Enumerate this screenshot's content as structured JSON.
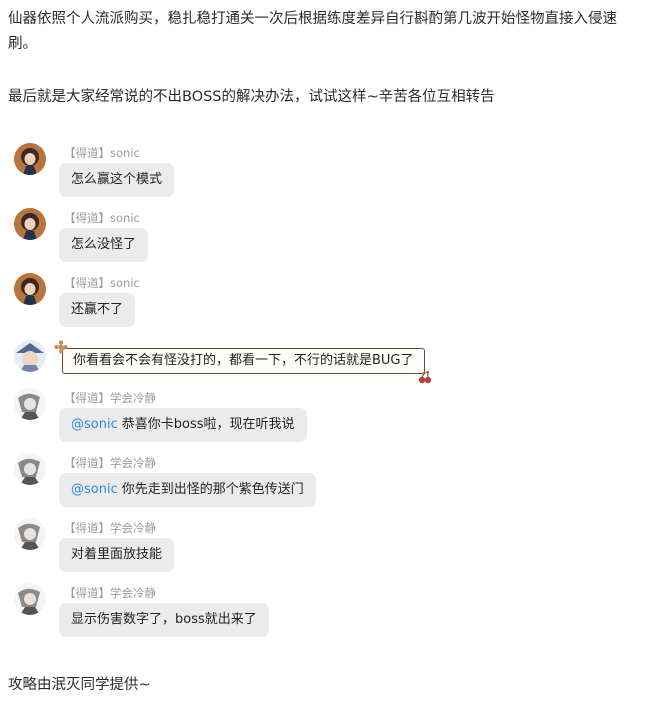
{
  "article": {
    "para1": "仙器依照个人流派购买，稳扎稳打通关一次后根据练度差异自行斟酌第几波开始怪物直接入侵速刷。",
    "para2": "最后就是大家经常说的不出BOSS的解决办法，试试这样~辛苦各位互相转告",
    "footer": "攻略由泯灭同学提供~"
  },
  "chat": {
    "messages": [
      {
        "tag": "【得道】",
        "name": "sonic",
        "text": "怎么赢这个模式"
      },
      {
        "tag": "【得道】",
        "name": "sonic",
        "text": "怎么没怪了"
      },
      {
        "tag": "【得道】",
        "name": "sonic",
        "text": "还赢不了"
      },
      {
        "text": "你看看会不会有怪没打的，都看一下，不行的话就是BUG了"
      },
      {
        "tag": "【得道】",
        "name": "学会冷静",
        "mention": "@sonic",
        "text": "恭喜你卡boss啦，现在听我说"
      },
      {
        "tag": "【得道】",
        "name": "学会冷静",
        "mention": "@sonic",
        "text": "你先走到出怪的那个紫色传送门"
      },
      {
        "tag": "【得道】",
        "name": "学会冷静",
        "text": "对着里面放技能"
      },
      {
        "tag": "【得道】",
        "name": "学会冷静",
        "text": "显示伤害数字了，boss就出来了"
      }
    ]
  },
  "colors": {
    "mention": "#2f87d8",
    "bubble": "#ebebeb",
    "meta": "#9b9b9b",
    "special_border": "#6d4a2b"
  },
  "icons": {
    "sonic_avatar": "anime-character-avatar",
    "moderator_avatar": "anime-avatar-with-hat",
    "xuehui_avatar": "sketched-character-avatar"
  }
}
